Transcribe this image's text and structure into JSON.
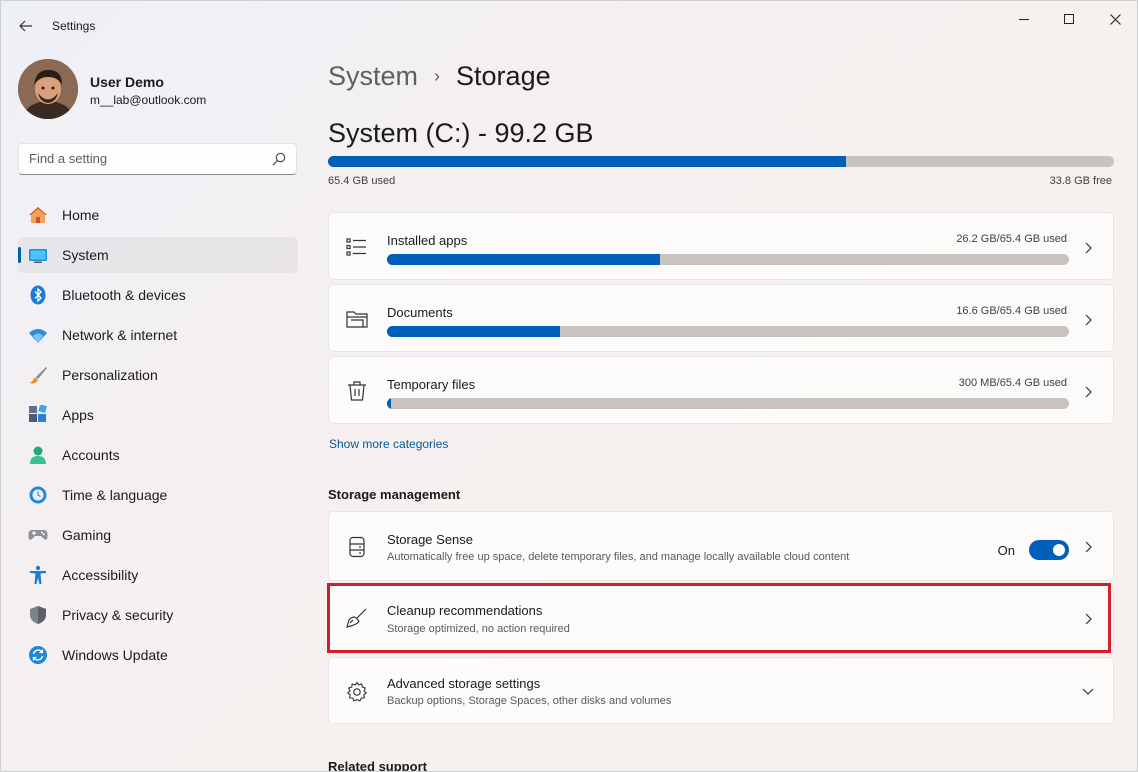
{
  "app": {
    "title": "Settings"
  },
  "user": {
    "name": "User Demo",
    "email": "m__lab@outlook.com"
  },
  "search": {
    "placeholder": "Find a setting"
  },
  "nav": {
    "items": [
      {
        "label": "Home",
        "icon": "home-icon",
        "active": false
      },
      {
        "label": "System",
        "icon": "monitor-icon",
        "active": true
      },
      {
        "label": "Bluetooth & devices",
        "icon": "bluetooth-icon",
        "active": false
      },
      {
        "label": "Network & internet",
        "icon": "wifi-icon",
        "active": false
      },
      {
        "label": "Personalization",
        "icon": "brush-icon",
        "active": false
      },
      {
        "label": "Apps",
        "icon": "apps-icon",
        "active": false
      },
      {
        "label": "Accounts",
        "icon": "person-icon",
        "active": false
      },
      {
        "label": "Time & language",
        "icon": "globe-clock-icon",
        "active": false
      },
      {
        "label": "Gaming",
        "icon": "gamepad-icon",
        "active": false
      },
      {
        "label": "Accessibility",
        "icon": "accessibility-icon",
        "active": false
      },
      {
        "label": "Privacy & security",
        "icon": "shield-icon",
        "active": false
      },
      {
        "label": "Windows Update",
        "icon": "update-icon",
        "active": false
      }
    ]
  },
  "breadcrumb": {
    "parent": "System",
    "separator": "›",
    "current": "Storage"
  },
  "drive": {
    "title": "System (C:) - 99.2 GB",
    "used": "65.4 GB used",
    "free": "33.8 GB free",
    "used_fraction": 0.659
  },
  "categories": [
    {
      "title": "Installed apps",
      "usage": "26.2 GB/65.4 GB used",
      "fraction": 0.4,
      "icon": "list-icon"
    },
    {
      "title": "Documents",
      "usage": "16.6 GB/65.4 GB used",
      "fraction": 0.254,
      "icon": "folder-icon"
    },
    {
      "title": "Temporary files",
      "usage": "300 MB/65.4 GB used",
      "fraction": 0.005,
      "icon": "trash-icon"
    }
  ],
  "show_more": "Show more categories",
  "storage_management": {
    "title": "Storage management",
    "storage_sense": {
      "title": "Storage Sense",
      "description": "Automatically free up space, delete temporary files, and manage locally available cloud content",
      "state": "On"
    },
    "cleanup": {
      "title": "Cleanup recommendations",
      "description": "Storage optimized, no action required"
    },
    "advanced": {
      "title": "Advanced storage settings",
      "description": "Backup options, Storage Spaces, other disks and volumes"
    }
  },
  "related_support": {
    "title": "Related support"
  },
  "colors": {
    "accent": "#005fb8",
    "highlight": "#d21f2a",
    "bar_track": "#c7c3be"
  }
}
